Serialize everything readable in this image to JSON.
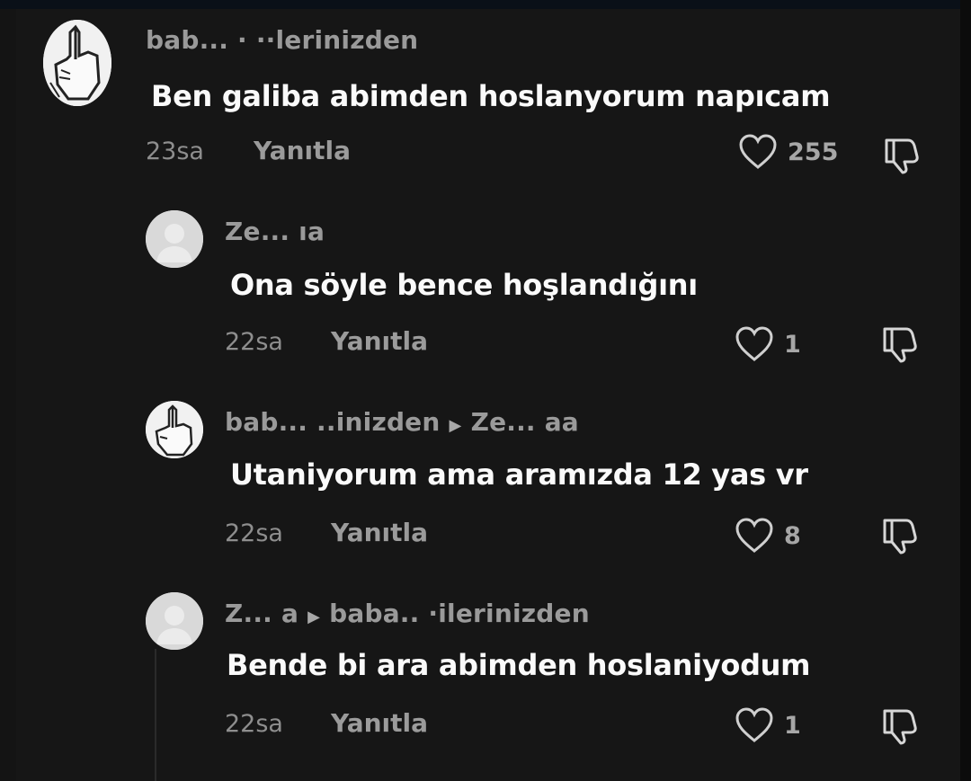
{
  "comments": [
    {
      "username": "bab... ·   ··lerinizden",
      "reply_to": "",
      "text": "Ben galiba abimden hoslanyorum napıcam",
      "time": "23sa",
      "reply_label": "Yanıtla",
      "likes": "255",
      "avatar": "custom-hand-avatar"
    },
    {
      "username": "Ze... ıa",
      "reply_to": "",
      "text": "Ona söyle bence hoşlandığını",
      "time": "22sa",
      "reply_label": "Yanıtla",
      "likes": "1",
      "avatar": "default-avatar"
    },
    {
      "username": "bab...                ..inizden",
      "reply_to": "Ze... aa",
      "text": "Utaniyorum ama aramızda 12 yas vr",
      "time": "22sa",
      "reply_label": "Yanıtla",
      "likes": "8",
      "avatar": "custom-hand-avatar"
    },
    {
      "username": "Z... a",
      "reply_to": "baba..        ·ilerinizden",
      "text": "Bende bi ara abimden hoslaniyodum",
      "time": "22sa",
      "reply_label": "Yanıtla",
      "likes": "1",
      "avatar": "default-avatar"
    }
  ],
  "icons": {
    "like": "heart-outline-icon",
    "dislike": "thumbs-down-icon",
    "reply_arrow": "triangle-right-icon"
  },
  "colors": {
    "background": "#161616",
    "text": "#fafafa",
    "muted": "#8e8e8e"
  }
}
